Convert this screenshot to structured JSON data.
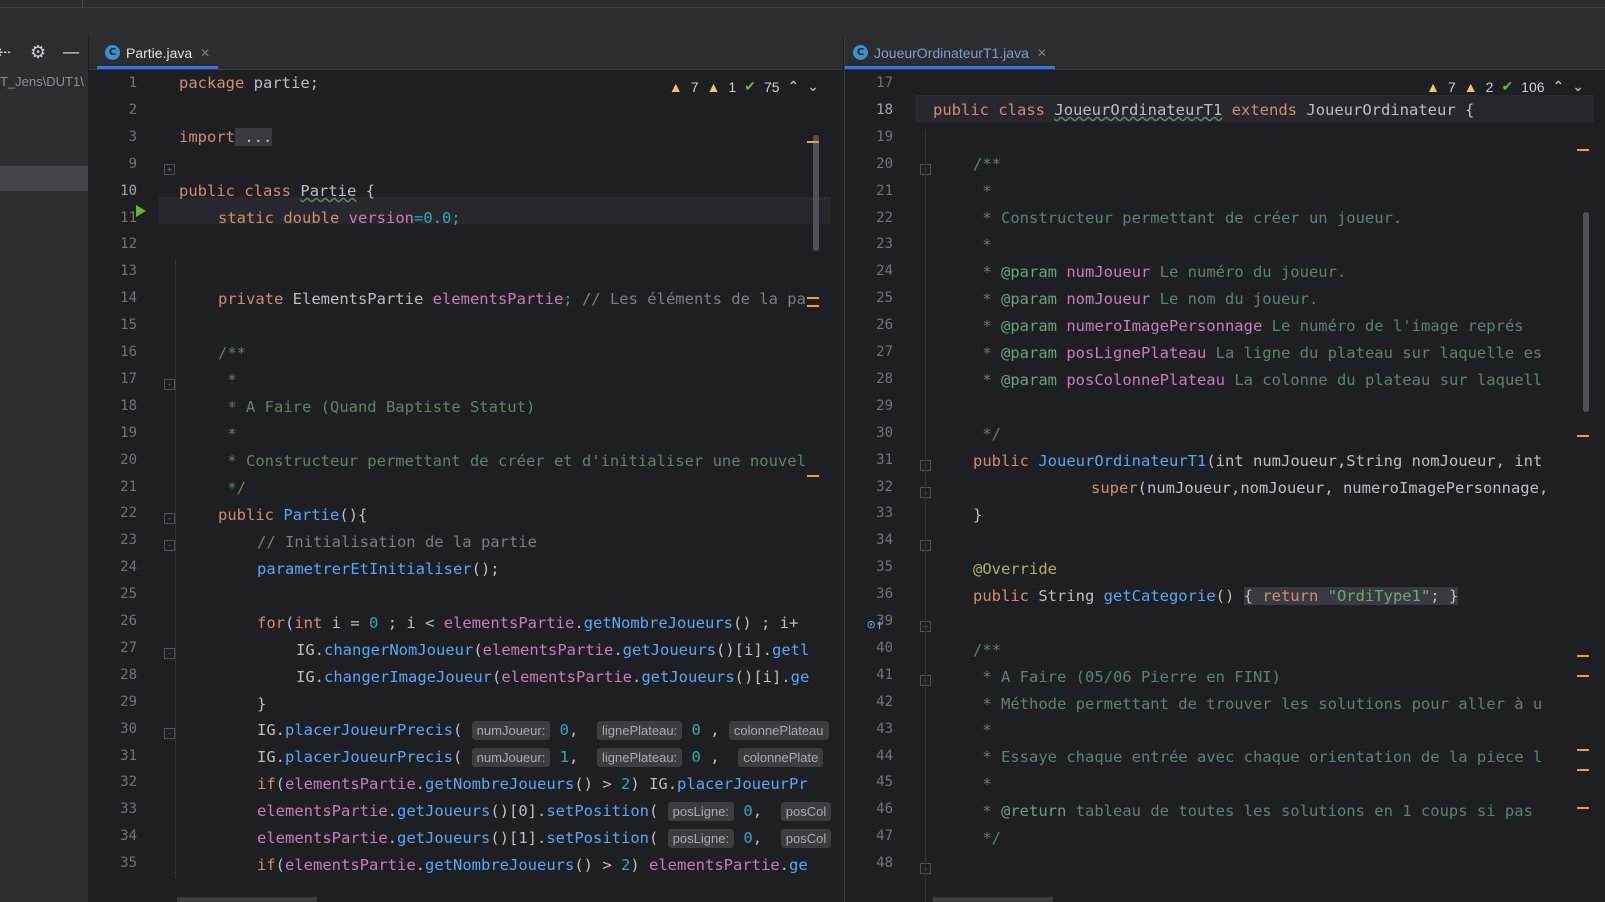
{
  "left_panel": {
    "path_text": "T_Jens\\DUT1\\"
  },
  "left_editor": {
    "tab_label": "Partie.java",
    "tab_icon": "java-class-icon",
    "inspections": {
      "warnings": "7",
      "weak_warnings": "1",
      "ok": "75"
    },
    "lines": [
      {
        "n": "1"
      },
      {
        "n": "2"
      },
      {
        "n": "3"
      },
      {
        "n": "9"
      },
      {
        "n": "10"
      },
      {
        "n": "11"
      },
      {
        "n": "12"
      },
      {
        "n": "13"
      },
      {
        "n": "14"
      },
      {
        "n": "15"
      },
      {
        "n": "16"
      },
      {
        "n": "17"
      },
      {
        "n": "18"
      },
      {
        "n": "19"
      },
      {
        "n": "20"
      },
      {
        "n": "21"
      },
      {
        "n": "22"
      },
      {
        "n": "23"
      },
      {
        "n": "24"
      },
      {
        "n": "25"
      },
      {
        "n": "26"
      },
      {
        "n": "27"
      },
      {
        "n": "28"
      },
      {
        "n": "29"
      },
      {
        "n": "30"
      },
      {
        "n": "31"
      },
      {
        "n": "32"
      },
      {
        "n": "33"
      },
      {
        "n": "34"
      },
      {
        "n": "35"
      }
    ],
    "text": {
      "package_kw": "package",
      "package_name": " partie;",
      "import_kw": "import",
      "import_dots": " ...",
      "public": "public",
      "class": "class",
      "class_name": "Partie",
      "brace_open": " {",
      "static_double": "static double ",
      "version": "version",
      "version_val": "=0.0;",
      "private": "private ",
      "type_elements": "ElementsPartie ",
      "field_elements": "elementsPartie",
      "comment14": "; // Les éléments de la pa",
      "doc_open": "/**",
      "doc_star": " *",
      "doc18": " * A Faire (Quand Baptiste Statut)",
      "doc20": " * Constructeur permettant de créer et d'initialiser une nouvel",
      "doc_close": " */",
      "ctor": "Partie",
      "ctor_rest": "(){",
      "comment23": "// Initialisation de la partie",
      "call24": "parametrerEtInitialiser",
      "call24_rest": "();",
      "for_kw": "for",
      "for_int": "int",
      "for_rest1": " i = ",
      "zero": "0",
      "for_rest2": " ; i < ",
      "getNombreJoueurs": "getNombreJoueurs",
      "for_rest3": "() ; i+",
      "IG": "IG",
      "changerNomJoueur": "changerNomJoueur",
      "getJoueurs": "getJoueurs",
      "idx_i": "()[i].",
      "getl": "getl",
      "changerImageJoueur": "changerImageJoueur",
      "ge": "ge",
      "close_brace": "}",
      "placerJoueurPrecis": "placerJoueurPrecis",
      "hint_numJoueur": "numJoueur:",
      "hint_lignePlateau": "lignePlateau:",
      "hint_colonnePlateau": "colonnePlateau",
      "hint_colonnePlate": "colonnePlate",
      "one": "1",
      "two": "2",
      "if_kw": "if",
      "gt": "() > ",
      "placerJoueurPr": "placerJoueurPr",
      "setPosition": "setPosition",
      "hint_posLigne": "posLigne:",
      "hint_posCol": "posCol",
      "idx0": "()[0].",
      "idx1": "()[1].",
      "ge2": "ge"
    }
  },
  "right_editor": {
    "tab_label": "JoueurOrdinateurT1.java",
    "tab_icon": "java-class-icon",
    "inspections": {
      "warnings": "7",
      "weak_warnings": "2",
      "ok": "106"
    },
    "lines": [
      {
        "n": "17"
      },
      {
        "n": "18"
      },
      {
        "n": "19"
      },
      {
        "n": "20"
      },
      {
        "n": "21"
      },
      {
        "n": "22"
      },
      {
        "n": "23"
      },
      {
        "n": "24"
      },
      {
        "n": "25"
      },
      {
        "n": "26"
      },
      {
        "n": "27"
      },
      {
        "n": "28"
      },
      {
        "n": "29"
      },
      {
        "n": "30"
      },
      {
        "n": "31"
      },
      {
        "n": "32"
      },
      {
        "n": "33"
      },
      {
        "n": "34"
      },
      {
        "n": "35"
      },
      {
        "n": "36"
      },
      {
        "n": "39"
      },
      {
        "n": "40"
      },
      {
        "n": "41"
      },
      {
        "n": "42"
      },
      {
        "n": "43"
      },
      {
        "n": "44"
      },
      {
        "n": "45"
      },
      {
        "n": "46"
      },
      {
        "n": "47"
      },
      {
        "n": "48"
      }
    ],
    "text": {
      "public": "public",
      "class": "class",
      "cls": "JoueurOrdinateurT1",
      "extends": "extends",
      "parent": "JoueurOrdinateur",
      "brace": " {",
      "doc_open": "/**",
      "doc_star": " *",
      "doc22": " * Constructeur permettant de créer un joueur.",
      "param": "@param",
      "p24": " numJoueur",
      "d24": " Le numéro du joueur.",
      "p25": " nomJoueur",
      "d25": " Le nom du joueur.",
      "p26": " numeroImagePersonnage",
      "d26": " Le numéro de l'image représ",
      "p27": " posLignePlateau",
      "d27": " La ligne du plateau sur laquelle es",
      "p28": " posColonnePlateau",
      "d28": " La colonne du plateau sur laquell",
      "doc_close": " */",
      "ctor": "JoueurOrdinateurT1",
      "ctor_args": "(int numJoueur,String nomJoueur, int",
      "super": "super",
      "super_args": "(numJoueur,nomJoueur, numeroImagePersonnage,",
      "close": "}",
      "override": "@Override",
      "string": " String ",
      "getCategorie": "getCategorie",
      "paren": "() ",
      "ret_open": "{ ",
      "return": "return ",
      "ret_str": "\"OrdiType1\"",
      "ret_close": "; }",
      "doc41": " * A Faire (05/06 Pierre en FINI)",
      "doc42": " * Méthode permettant de trouver les solutions pour aller à u",
      "doc44": " * Essaye chaque entrée avec chaque orientation de la piece l",
      "return_tag": "@return",
      "doc46": " tableau de toutes les solutions en 1 coups si pas"
    }
  }
}
